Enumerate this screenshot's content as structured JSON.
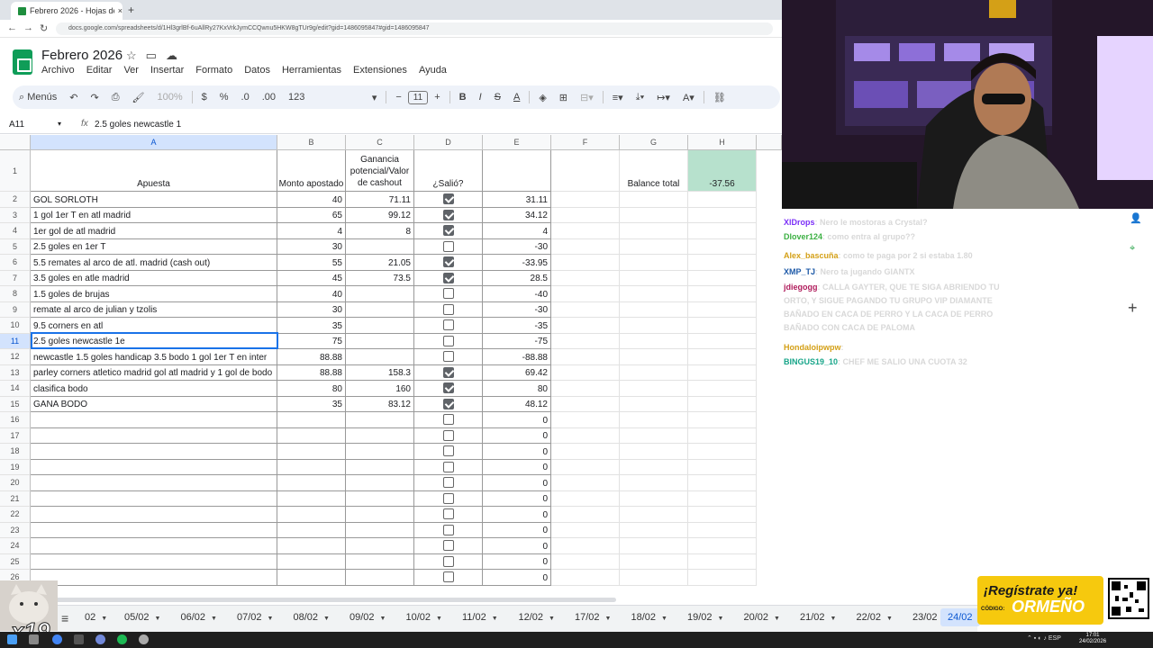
{
  "browser": {
    "tab_title": "Febrero 2026 - Hojas de cálculo",
    "tab_close": "×",
    "new_tab": "+",
    "url": "docs.google.com/spreadsheets/d/1Hl3grlBf-6uAllRy27KxVrkJymCCQwnu5HKW8gTUr9g/edit?gid=1486095847#gid=1486095847"
  },
  "doc": {
    "title": "Febrero 2026",
    "menu": [
      "Archivo",
      "Editar",
      "Ver",
      "Insertar",
      "Formato",
      "Datos",
      "Herramientas",
      "Extensiones",
      "Ayuda"
    ]
  },
  "toolbar": {
    "search": "Menús",
    "zoom": "100%",
    "currency": "$",
    "percent": "%",
    "dec_dec": ".0",
    "dec_inc": ".00",
    "format_123": "123",
    "font_size": "11",
    "minus": "−",
    "plus": "+",
    "bold": "B",
    "italic": "I",
    "strike": "S",
    "color_a": "A"
  },
  "formula_bar": {
    "cell_ref": "A11",
    "fx": "fx",
    "content": "2.5 goles newcastle 1"
  },
  "columns": [
    "A",
    "B",
    "C",
    "D",
    "E",
    "F",
    "G",
    "H"
  ],
  "header_row": {
    "a": "Apuesta",
    "b": "Monto apostado",
    "c": "Ganancia potencial/Valor de cashout",
    "d": "¿Salió?",
    "g": "Balance total",
    "h": "-37.56"
  },
  "rows": [
    {
      "n": "2",
      "a": "GOL SORLOTH",
      "b": "40",
      "c": "71.11",
      "d": true,
      "e": "31.11"
    },
    {
      "n": "3",
      "a": "1 gol 1er T en atl madrid",
      "b": "65",
      "c": "99.12",
      "d": true,
      "e": "34.12"
    },
    {
      "n": "4",
      "a": "1er gol de atl madrid",
      "b": "4",
      "c": "8",
      "d": true,
      "e": "4"
    },
    {
      "n": "5",
      "a": "2.5 goles en 1er T",
      "b": "30",
      "c": "",
      "d": false,
      "e": "-30"
    },
    {
      "n": "6",
      "a": "5.5 remates al arco de atl. madrid (cash out)",
      "b": "55",
      "c": "21.05",
      "d": true,
      "e": "-33.95"
    },
    {
      "n": "7",
      "a": "3.5 goles en atle madrid",
      "b": "45",
      "c": "73.5",
      "d": true,
      "e": "28.5"
    },
    {
      "n": "8",
      "a": "1.5 goles de brujas",
      "b": "40",
      "c": "",
      "d": false,
      "e": "-40"
    },
    {
      "n": "9",
      "a": "remate al arco de julian y tzolis",
      "b": "30",
      "c": "",
      "d": false,
      "e": "-30"
    },
    {
      "n": "10",
      "a": "9.5 corners en atl",
      "b": "35",
      "c": "",
      "d": false,
      "e": "-35"
    },
    {
      "n": "11",
      "a": "2.5 goles newcastle 1e",
      "b": "75",
      "c": "",
      "d": false,
      "e": "-75"
    },
    {
      "n": "12",
      "a": "newcastle 1.5 goles handicap 3.5 bodo 1 gol 1er T en inter",
      "b": "88.88",
      "c": "",
      "d": false,
      "e": "-88.88"
    },
    {
      "n": "13",
      "a": "parley corners atletico madrid gol atl madrid y 1 gol de bodo",
      "b": "88.88",
      "c": "158.3",
      "d": true,
      "e": "69.42"
    },
    {
      "n": "14",
      "a": "clasifica bodo",
      "b": "80",
      "c": "160",
      "d": true,
      "e": "80"
    },
    {
      "n": "15",
      "a": "GANA BODO",
      "b": "35",
      "c": "83.12",
      "d": true,
      "e": "48.12"
    },
    {
      "n": "16",
      "a": "",
      "b": "",
      "c": "",
      "d": false,
      "e": "0"
    },
    {
      "n": "17",
      "a": "",
      "b": "",
      "c": "",
      "d": false,
      "e": "0"
    },
    {
      "n": "18",
      "a": "",
      "b": "",
      "c": "",
      "d": false,
      "e": "0"
    },
    {
      "n": "19",
      "a": "",
      "b": "",
      "c": "",
      "d": false,
      "e": "0"
    },
    {
      "n": "20",
      "a": "",
      "b": "",
      "c": "",
      "d": false,
      "e": "0"
    },
    {
      "n": "21",
      "a": "",
      "b": "",
      "c": "",
      "d": false,
      "e": "0"
    },
    {
      "n": "22",
      "a": "",
      "b": "",
      "c": "",
      "d": false,
      "e": "0"
    },
    {
      "n": "23",
      "a": "",
      "b": "",
      "c": "",
      "d": false,
      "e": "0"
    },
    {
      "n": "24",
      "a": "",
      "b": "",
      "c": "",
      "d": false,
      "e": "0"
    },
    {
      "n": "25",
      "a": "",
      "b": "",
      "c": "",
      "d": false,
      "e": "0"
    },
    {
      "n": "26",
      "a": "",
      "b": "",
      "c": "",
      "d": false,
      "e": "0"
    }
  ],
  "sheet_tabs": [
    "02",
    "05/02",
    "06/02",
    "07/02",
    "08/02",
    "09/02",
    "10/02",
    "11/02",
    "12/02",
    "17/02",
    "18/02",
    "19/02",
    "20/02",
    "21/02",
    "22/02",
    "23/02"
  ],
  "active_sheet": "24/02",
  "chat": [
    {
      "user": "XlDrops",
      "msg": "Nero le mostoras a Crystal?",
      "color": "#7b2ff7"
    },
    {
      "user": "Dlover124",
      "msg": "como entra al grupo??",
      "color": "#3cb043"
    },
    {
      "user": "Alex_bascuña",
      "msg": "como te paga por 2 si estaba 1.80",
      "color": "#d4a017"
    },
    {
      "user": "XMP_TJ",
      "msg": "Nero ta jugando GIANTX",
      "color": "#1e5aa8"
    },
    {
      "user": "jdiegogg",
      "msg": "CALLA GAYTER, QUE TE SIGA ABRIENDO TU ORTO, Y SIGUE PAGANDO TU GRUPO VIP DIAMANTE BAÑADO EN CACA DE PERRO Y LA CACA DE PERRO BAÑADO CON CACA DE PALOMA",
      "color": "#b01c5c"
    },
    {
      "user": "Hondaloipwpw",
      "msg": "",
      "color": "#d4a017"
    },
    {
      "user": "BINGUS19_10",
      "msg": "CHEF ME SALIO UNA CUOTA 32",
      "color": "#17a589"
    }
  ],
  "promo": {
    "line1": "¡Regístrate ya!",
    "code_label": "CÓDIGO:",
    "code": "ORMEÑO"
  },
  "overlay": {
    "cat_label": "x19"
  },
  "taskbar": {
    "time": "17:01",
    "date": "24/02/2026",
    "lang": "ESP"
  }
}
